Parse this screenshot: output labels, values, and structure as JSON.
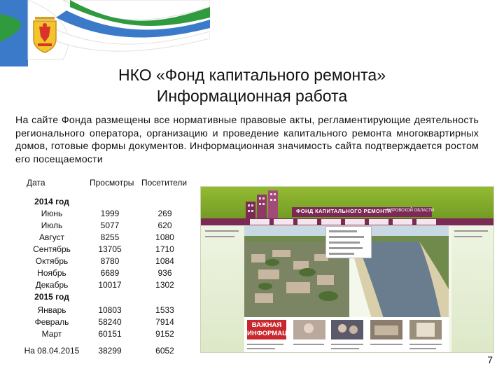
{
  "title_line1": "НКО «Фонд капитального ремонта»",
  "title_line2": "Информационная работа",
  "paragraph": "На сайте Фонда размещены все нормативные правовые акты, регламентирующие деятельность регионального оператора, организацию и проведение капитального ремонта многоквартирных домов, готовые формы документов.   Информационная значимость сайта подтверждается ростом его посещаемости",
  "table": {
    "headers": [
      "Дата",
      "Просмотры",
      "Посетители"
    ],
    "rows": [
      {
        "label": "2014 год",
        "views": "",
        "visitors": "",
        "year": true
      },
      {
        "label": "Июнь",
        "views": "1999",
        "visitors": "269"
      },
      {
        "label": "Июль",
        "views": "5077",
        "visitors": "620"
      },
      {
        "label": "Август",
        "views": "8255",
        "visitors": "1080"
      },
      {
        "label": "Сентябрь",
        "views": "13705",
        "visitors": "1710"
      },
      {
        "label": "Октябрь",
        "views": "8780",
        "visitors": "1084"
      },
      {
        "label": "Ноябрь",
        "views": "6689",
        "visitors": "936"
      },
      {
        "label": "Декабрь",
        "views": "10017",
        "visitors": "1302"
      },
      {
        "label": "2015 год",
        "views": "",
        "visitors": "",
        "year": true
      },
      {
        "label": "Январь",
        "views": "10803",
        "visitors": "1533"
      },
      {
        "label": "Февраль",
        "views": "58240",
        "visitors": "7914"
      },
      {
        "label": "Март",
        "views": "60151",
        "visitors": "9152"
      },
      {
        "label": "На 08.04.2015",
        "views": "38299",
        "visitors": "6052"
      }
    ]
  },
  "site": {
    "brand": "ФОНД КАПИТАЛЬНОГО РЕМОНТА",
    "region": "КИРОВСКОЙ ОБЛАСТИ",
    "banner": "ВАЖНАЯ ИНФОРМАЦИЯ"
  },
  "page_number": "7",
  "colors": {
    "flag_white": "#ffffff",
    "flag_green": "#2f9a3e",
    "flag_blue": "#3a7ac8",
    "site_green": "#86ad2c",
    "site_purple": "#7a2a55"
  }
}
